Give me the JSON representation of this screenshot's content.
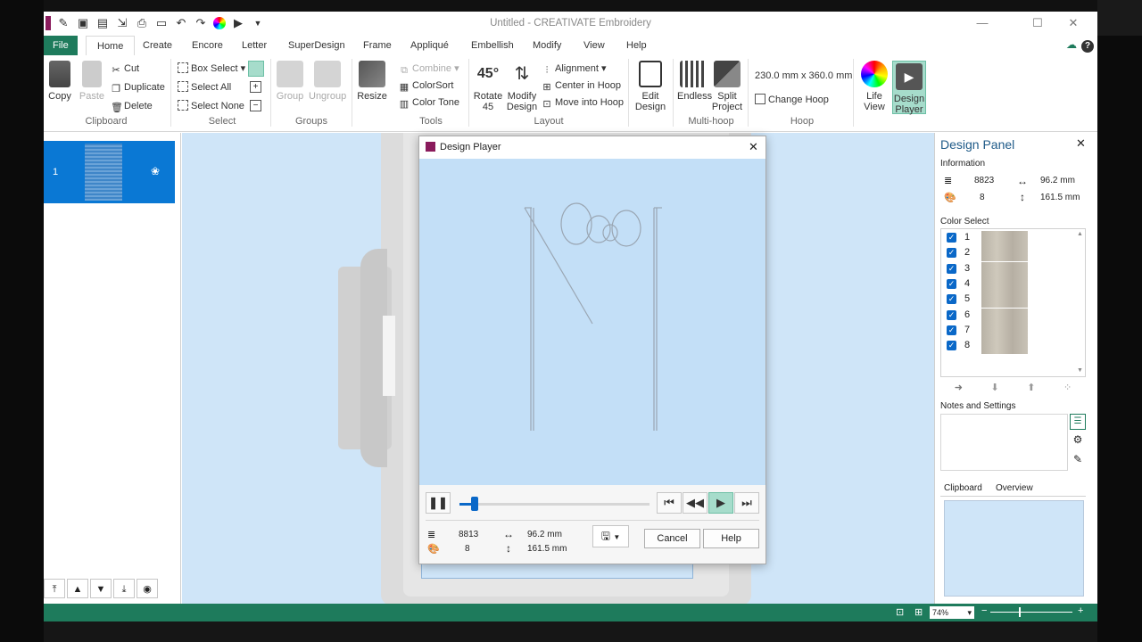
{
  "app": {
    "title": "Untitled - CREATIVATE Embroidery"
  },
  "menu": {
    "file": "File",
    "tabs": [
      "Home",
      "Create",
      "Encore",
      "Letter",
      "SuperDesign",
      "Frame",
      "Appliqué",
      "Embellish",
      "Modify",
      "View",
      "Help"
    ]
  },
  "ribbon": {
    "clipboard": {
      "copy": "Copy",
      "paste": "Paste",
      "cut": "Cut",
      "duplicate": "Duplicate",
      "delete": "Delete",
      "group": "Clipboard"
    },
    "select": {
      "box_select": "Box Select",
      "select_all": "Select All",
      "select_none": "Select None",
      "group": "Select"
    },
    "groups": {
      "group_btn": "Group",
      "ungroup_btn": "Ungroup",
      "group": "Groups"
    },
    "tools": {
      "resize": "Resize",
      "combine": "Combine",
      "colorsort": "ColorSort",
      "colortone": "Color Tone",
      "group": "Tools"
    },
    "layout": {
      "rotate_line1": "Rotate",
      "rotate_line2": "45",
      "modify_line1": "Modify",
      "modify_line2": "Design",
      "alignment": "Alignment",
      "center_in_hoop": "Center in Hoop",
      "move_into_hoop": "Move into Hoop",
      "group": "Layout"
    },
    "edit": {
      "line1": "Edit",
      "line2": "Design"
    },
    "multihoop": {
      "endless": "Endless",
      "split_line1": "Split",
      "split_line2": "Project",
      "group": "Multi-hoop"
    },
    "hoop": {
      "size": "230.0 mm x 360.0 mm",
      "change_hoop": "Change Hoop",
      "group": "Hoop"
    },
    "view": {
      "life_line1": "Life",
      "life_line2": "View",
      "player_line1": "Design",
      "player_line2": "Player"
    }
  },
  "left_panel": {
    "item_number": "1"
  },
  "design_panel": {
    "title": "Design Panel",
    "information_label": "Information",
    "stitches": "8823",
    "width": "96.2 mm",
    "colors": "8",
    "height": "161.5 mm",
    "color_select_label": "Color Select",
    "color_numbers": [
      "1",
      "2",
      "3",
      "4",
      "5",
      "6",
      "7",
      "8"
    ],
    "notes_label": "Notes and Settings",
    "tab_clipboard": "Clipboard",
    "tab_overview": "Overview"
  },
  "design_player": {
    "title": "Design Player",
    "stitches": "8813",
    "width": "96.2 mm",
    "colors": "8",
    "height": "161.5 mm",
    "progress": 0.08,
    "cancel_label": "Cancel",
    "help_label": "Help"
  },
  "status": {
    "zoom": "74%"
  },
  "colors": {
    "accent": "#1e7b5c",
    "selection_blue": "#0a78d4",
    "canvas": "#cfe5f8",
    "hoop_gray": "#dcdcdc"
  }
}
